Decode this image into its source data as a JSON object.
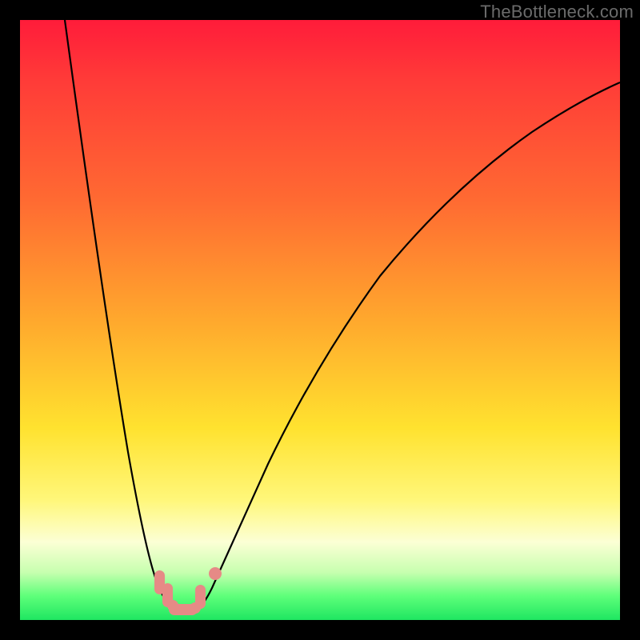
{
  "watermark": "TheBottleneck.com",
  "colors": {
    "gradient_top": "#ff1c3a",
    "gradient_mid1": "#ff6a32",
    "gradient_mid2": "#ffe22f",
    "gradient_bottom": "#1fe661",
    "pill": "#e68a86",
    "curve": "#000000",
    "frame": "#000000"
  },
  "chart_data": {
    "type": "line",
    "title": "",
    "xlabel": "",
    "ylabel": "",
    "xlim": [
      0,
      100
    ],
    "ylim": [
      0,
      100
    ],
    "grid": false,
    "legend": false,
    "note": "V-shaped bottleneck curve. x is normalized horizontal position (0=left, 100=right). y is normalized bottleneck/mismatch (0=bottom/green=good, 100=top/red=bad). Minimum near x≈26.",
    "series": [
      {
        "name": "bottleneck",
        "x": [
          0,
          5,
          10,
          15,
          18,
          20,
          22,
          23,
          24,
          25,
          26,
          27,
          28,
          29,
          30,
          32,
          35,
          40,
          45,
          50,
          55,
          60,
          65,
          70,
          75,
          80,
          85,
          90,
          95,
          100
        ],
        "y": [
          100,
          85,
          67,
          47,
          32,
          21,
          11,
          6,
          3,
          1,
          0,
          0,
          1,
          2,
          4,
          8,
          17,
          30,
          41,
          50,
          57,
          63,
          68,
          73,
          77,
          80,
          83,
          85,
          87,
          88
        ]
      }
    ],
    "markers": [
      {
        "name": "cluster_left",
        "x": 23.5,
        "shape": "pill_vertical"
      },
      {
        "name": "cluster_left2",
        "x": 24.5,
        "shape": "pill_vertical"
      },
      {
        "name": "valley1",
        "x": 25.5,
        "shape": "dot"
      },
      {
        "name": "valley2",
        "x": 26.5,
        "shape": "dot"
      },
      {
        "name": "valley3",
        "x": 27.5,
        "shape": "dot"
      },
      {
        "name": "valley4",
        "x": 28.5,
        "shape": "dot"
      },
      {
        "name": "cluster_right",
        "x": 30.0,
        "shape": "pill_vertical"
      },
      {
        "name": "outlier_right",
        "x": 32.0,
        "shape": "dot"
      }
    ]
  }
}
